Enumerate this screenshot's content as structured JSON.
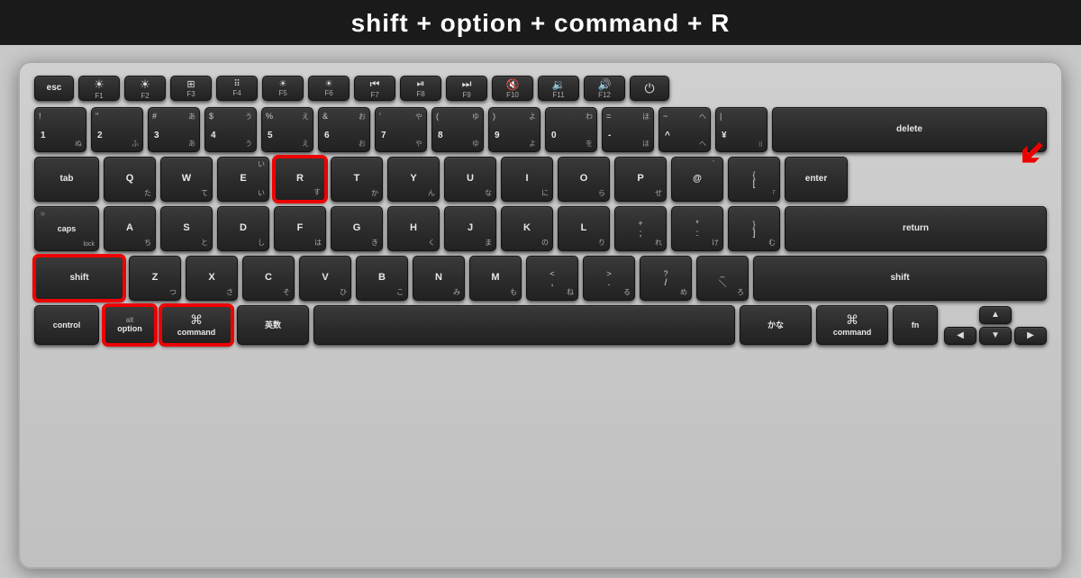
{
  "title": "shift + option + command + R",
  "keyboard": {
    "fn_row": [
      "esc",
      "F1",
      "F2",
      "F3",
      "F4",
      "F5",
      "F6",
      "F7",
      "F8",
      "F9",
      "F10",
      "F11",
      "F12",
      "power"
    ],
    "highlighted_keys": [
      "shift-left",
      "option",
      "command-left",
      "R"
    ],
    "shortcut_label": "shift + option + command + R"
  }
}
